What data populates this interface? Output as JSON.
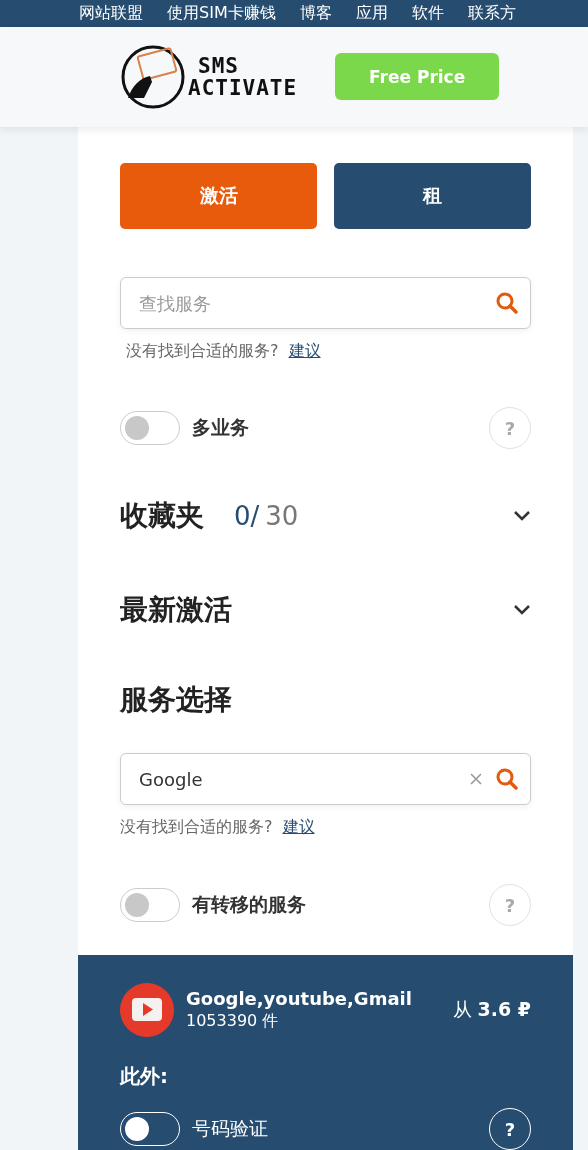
{
  "nav": {
    "items": [
      "网站联盟",
      "使用SIM卡赚钱",
      "博客",
      "应用",
      "软件",
      "联系方"
    ]
  },
  "header": {
    "logo": {
      "line_1": "SMS",
      "line_2": "ACTIVATE"
    },
    "button": "Free Price"
  },
  "tabs": [
    {
      "label": "激活",
      "selected": true
    },
    {
      "label": "租",
      "selected": false
    }
  ],
  "search": {
    "placeholder": "查找服务"
  },
  "search_hint": {
    "text": "没有找到合适的服务?",
    "link": "建议"
  },
  "multi_toggle": {
    "label": "多业务",
    "on": false,
    "help": "?"
  },
  "sections": [
    {
      "title": "收藏夹",
      "count": "0/",
      "total": "30",
      "expanded": false
    },
    {
      "title": "最新激活",
      "expanded": false
    }
  ],
  "service_select": {
    "title": "服务选择",
    "search_value": "Google",
    "hint": {
      "text": "没有找到合适的服务?",
      "link": "建议"
    },
    "toggle": {
      "label": "有转移的服务",
      "on": false,
      "help": "?"
    }
  },
  "result": {
    "name": "Google,youtube,Gmail",
    "count": "1053390 件",
    "price_prefix": "从",
    "price": "3.6 ₽",
    "extras_label": "此外:",
    "extras": [
      {
        "label": "号码验证",
        "on": false,
        "help": "?"
      }
    ]
  }
}
